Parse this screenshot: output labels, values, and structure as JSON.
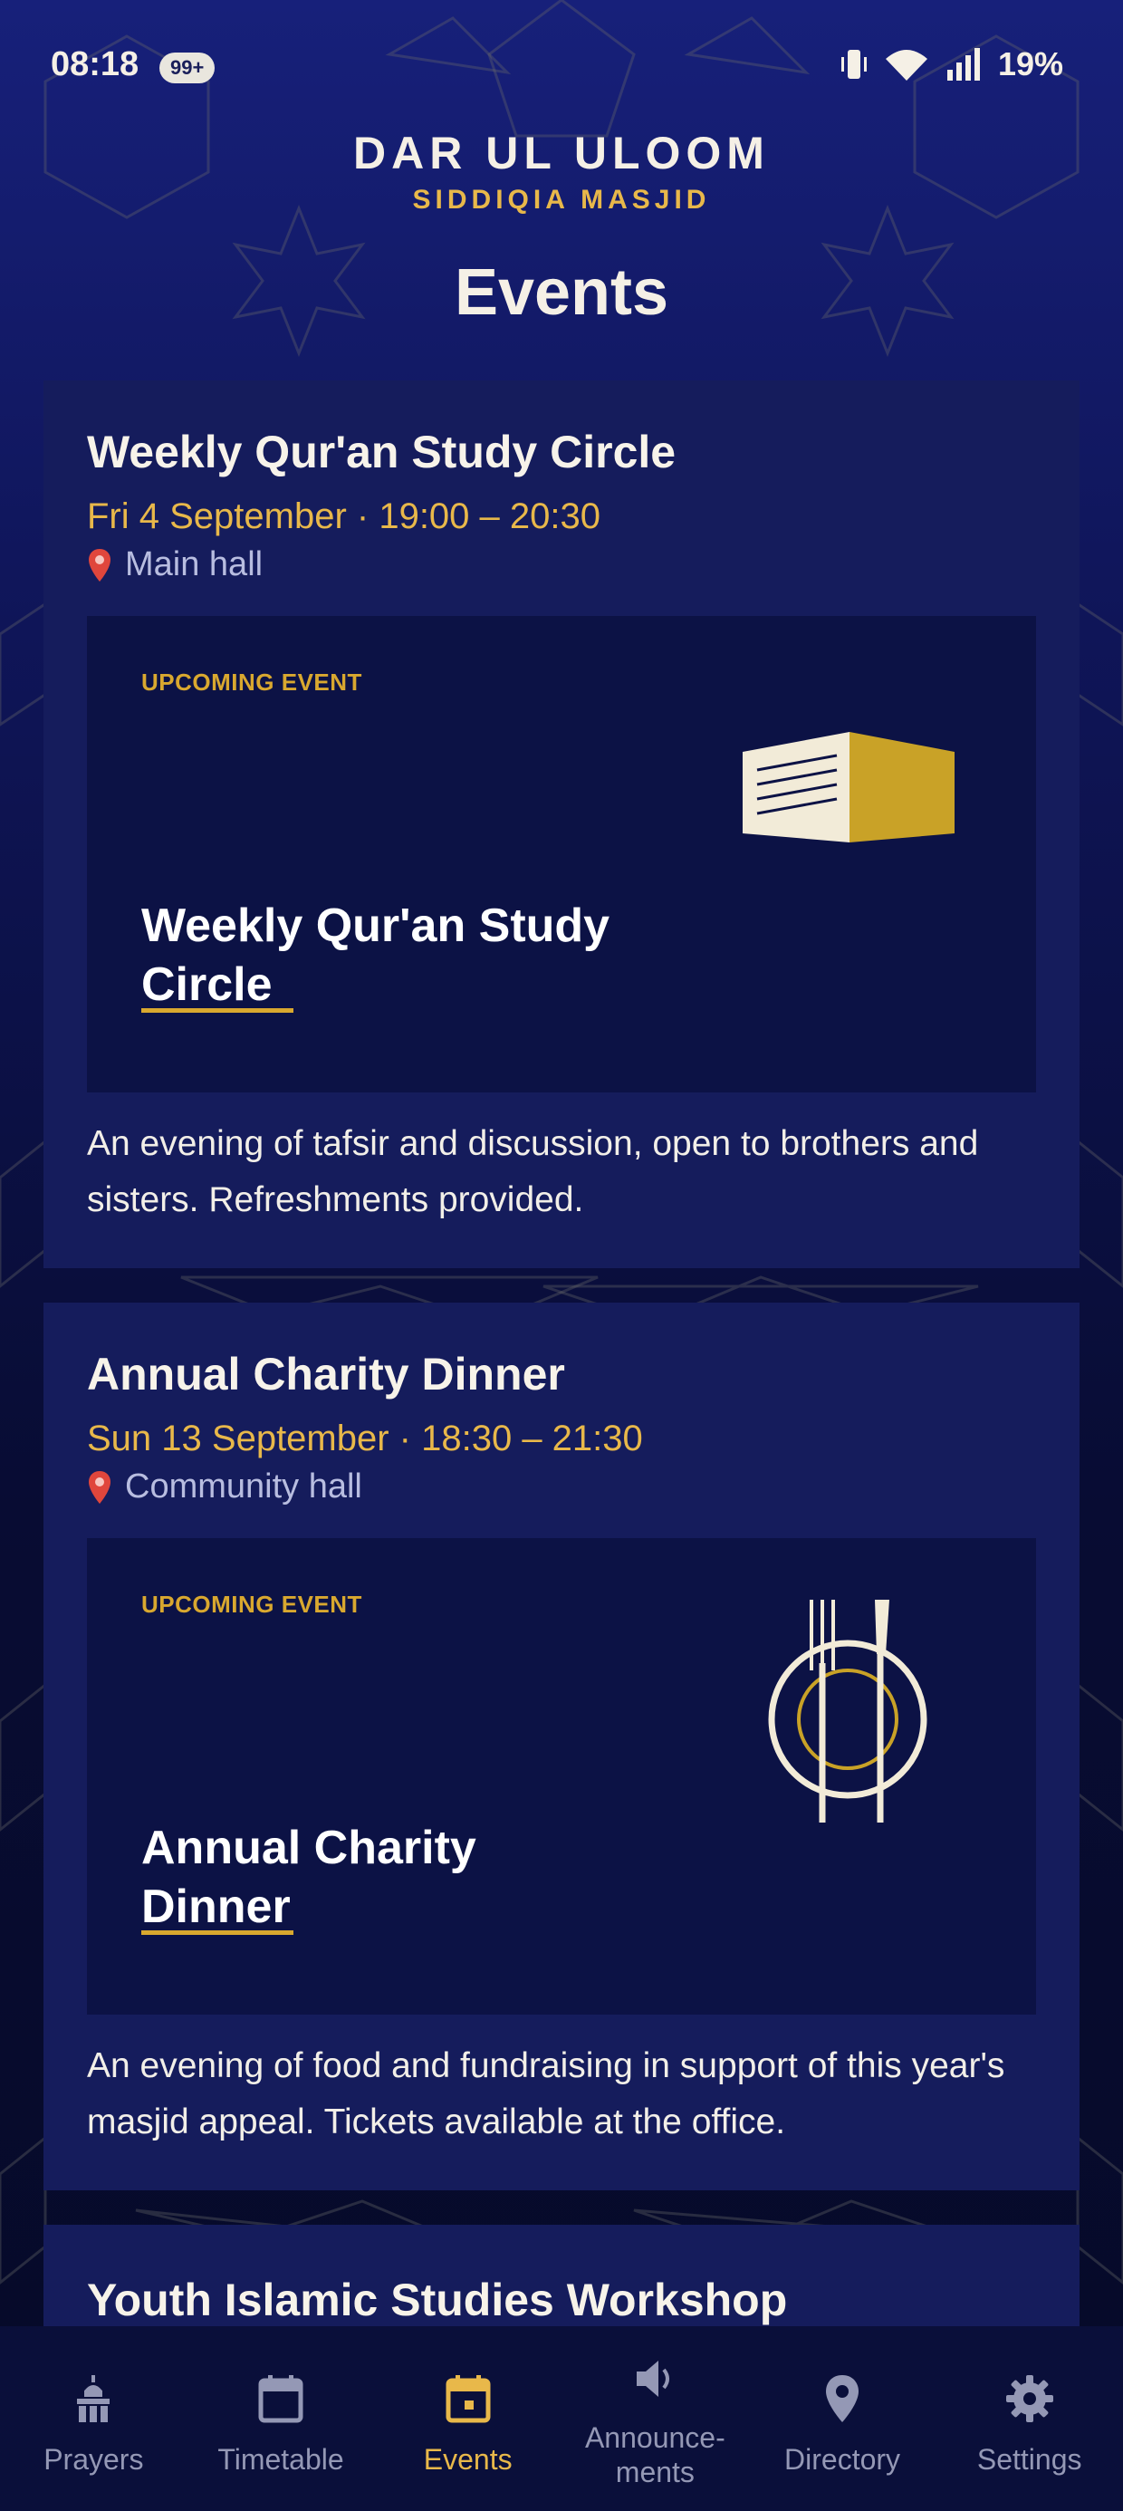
{
  "status_bar": {
    "time": "08:18",
    "notification_badge": "99+",
    "battery": "19%",
    "icons": [
      "vibrate-icon",
      "wifi-icon",
      "signal-icon"
    ]
  },
  "header": {
    "brand_title": "DAR UL ULOOM",
    "brand_subtitle": "SIDDIQIA MASJID",
    "page_title": "Events"
  },
  "events": [
    {
      "title": "Weekly Qur'an Study Circle",
      "when": "Fri 4 September · 19:00 – 20:30",
      "where": "Main hall",
      "poster_tag": "UPCOMING EVENT",
      "poster_title": "Weekly Qur'an Study Circle",
      "poster_icon": "book-icon",
      "description": "An evening of tafsir and discussion, open to brothers and sisters. Refreshments provided."
    },
    {
      "title": "Annual Charity Dinner",
      "when": "Sun 13 September · 18:30 – 21:30",
      "where": "Community hall",
      "poster_tag": "UPCOMING EVENT",
      "poster_title": "Annual Charity Dinner",
      "poster_icon": "dinner-plate-icon",
      "description": "An evening of food and fundraising in support of this year's masjid appeal. Tickets available at the office."
    },
    {
      "title": "Youth Islamic Studies Workshop"
    }
  ],
  "tabbar": {
    "tabs": [
      {
        "label": "Prayers",
        "icon": "mosque-icon",
        "active": false
      },
      {
        "label": "Timetable",
        "icon": "calendar-icon",
        "active": false
      },
      {
        "label": "Events",
        "icon": "calendar-event-icon",
        "active": true
      },
      {
        "label": "Announce-\nments",
        "icon": "speaker-icon",
        "active": false
      },
      {
        "label": "Directory",
        "icon": "location-pin-icon",
        "active": false
      },
      {
        "label": "Settings",
        "icon": "gear-icon",
        "active": false
      }
    ]
  },
  "colors": {
    "accent": "#e8b84a",
    "card_bg": "#151c5c",
    "poster_bg": "#0c1245",
    "page_bg": "#0b1040"
  }
}
